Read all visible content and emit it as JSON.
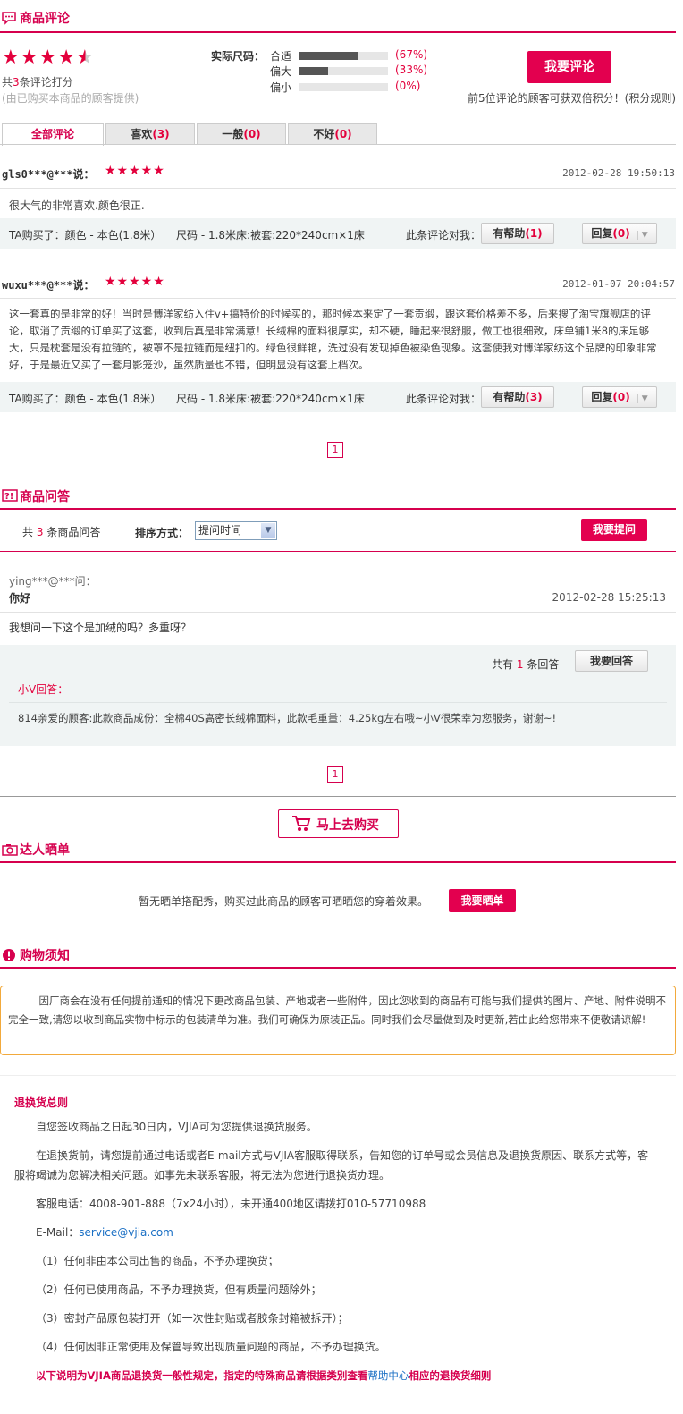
{
  "reviews_section": {
    "title": "商品评论",
    "rating_stars": 4.5,
    "summary_prefix": "共",
    "summary_count": "3",
    "summary_suffix": "条评论打分",
    "summary_note": "(由已购买本商品的顾客提供)",
    "size_label": "实际尺码：",
    "size_rows": [
      {
        "label": "合适",
        "percent_text": "(67%)",
        "fraction": 0.67
      },
      {
        "label": "偏大",
        "percent_text": "(33%)",
        "fraction": 0.33
      },
      {
        "label": "偏小",
        "percent_text": "(0%)",
        "fraction": 0
      }
    ],
    "write_review_button": "我要评论",
    "bonus_note": "前5位评论的顾客可获双倍积分！(积分规则)",
    "tabs": [
      {
        "label": "全部评论",
        "count": ""
      },
      {
        "label": "喜欢",
        "count": "(3)"
      },
      {
        "label": "一般",
        "count": "(0)"
      },
      {
        "label": "不好",
        "count": "(0)"
      }
    ],
    "items": [
      {
        "user": "gls0***@***说：",
        "stars": "★★★★★",
        "date": "2012-02-28 19:50:13",
        "content": "很大气的非常喜欢.颜色很正.",
        "purchase_color": "TA购买了：颜色 - 本色(1.8米）",
        "purchase_size": "尺码 - 1.8米床:被套:220*240cm×1床",
        "helpful_prompt": "此条评论对我：",
        "helpful_label": "有帮助",
        "helpful_count": "(1)",
        "reply_label": "回复",
        "reply_count": "(0)"
      },
      {
        "user": "wuxu***@***说：",
        "stars": "★★★★★",
        "date": "2012-01-07 20:04:57",
        "content": "这一套真的是非常的好！当时是博洋家纺入住v+搞特价的时候买的，那时候本来定了一套贡缎，跟这套价格差不多，后来搜了淘宝旗舰店的评论，取消了贡缎的订单买了这套，收到后真是非常满意！长绒棉的面料很厚实，却不硬，睡起来很舒服，做工也很细致，床单铺1米8的床足够大，只是枕套是没有拉链的，被罩不是拉链而是纽扣的。绿色很鲜艳，洗过没有发现掉色被染色现象。这套使我对博洋家纺这个品牌的印象非常好，于是最近又买了一套月影笼沙，虽然质量也不错，但明显没有这套上档次。",
        "purchase_color": "TA购买了：颜色 - 本色(1.8米）",
        "purchase_size": "尺码 - 1.8米床:被套:220*240cm×1床",
        "helpful_prompt": "此条评论对我：",
        "helpful_label": "有帮助",
        "helpful_count": "(3)",
        "reply_label": "回复",
        "reply_count": "(0)"
      }
    ],
    "page_number": "1"
  },
  "qa_section": {
    "title": "商品问答",
    "count_prefix": "共",
    "count": "3",
    "count_suffix": "条商品问答",
    "sort_label": "排序方式：",
    "sort_selected": "提问时间",
    "ask_button": "我要提问",
    "question_user": "ying***@***问：",
    "question_title": "你好",
    "question_date": "2012-02-28 15:25:13",
    "question_body": "我想问一下这个是加绒的吗？多重呀？",
    "answers_prefix": "共有",
    "answers_count": "1",
    "answers_suffix": "条回答",
    "answer_button": "我要回答",
    "answerer": "小V回答：",
    "answer_text": "814亲爱的顾客:此款商品成份：全棉40S高密长绒棉面料，此款毛重量：4.25kg左右哦~小V很荣幸为您服务，谢谢~!",
    "page_number": "1"
  },
  "buy_button": "马上去购买",
  "showcase_section": {
    "title": "达人晒单",
    "empty_text": "暂无晒单搭配秀，购买过此商品的顾客可晒晒您的穿着效果。",
    "share_button": "我要晒单"
  },
  "notice_section": {
    "title": "购物须知",
    "notice_text": "因厂商会在没有任何提前通知的情况下更改商品包装、产地或者一些附件，因此您收到的商品有可能与我们提供的图片、产地、附件说明不完全一致,请您以收到商品实物中标示的包装清单为准。我们可确保为原装正品。同时我们会尽量做到及时更新,若由此给您带来不便敬请谅解!"
  },
  "return_policy": {
    "heading": "退换货总则",
    "p1": "自您签收商品之日起30日内，VJIA可为您提供退换货服务。",
    "p2": "在退换货前，请您提前通过电话或者E-mail方式与VJIA客服取得联系，告知您的订单号或会员信息及退换货原因、联系方式等，客服将竭诚为您解决相关问题。如事先未联系客服，将无法为您进行退换货办理。",
    "phone": "客服电话：4008-901-888（7x24小时），未开通400地区请拨打010-57710988",
    "email_label": "E-Mail：",
    "email": "service@vjia.com",
    "rules": [
      "（1）任何非由本公司出售的商品，不予办理换货；",
      "（2）任何已使用商品，不予办理换货，但有质量问题除外；",
      "（3）密封产品原包装打开（如一次性封贴或者胶条封箱被拆开）；",
      "（4）任何因非正常使用及保管导致出现质量问题的商品，不予办理换货。"
    ],
    "footer_before": "以下说明为VJIA商品退换货一般性规定，指定的特殊商品请根据类别查看",
    "footer_link": "帮助中心",
    "footer_after": "相应的退换货细则"
  },
  "colors": {
    "accent": "#d6004e",
    "button": "#e3004f"
  }
}
